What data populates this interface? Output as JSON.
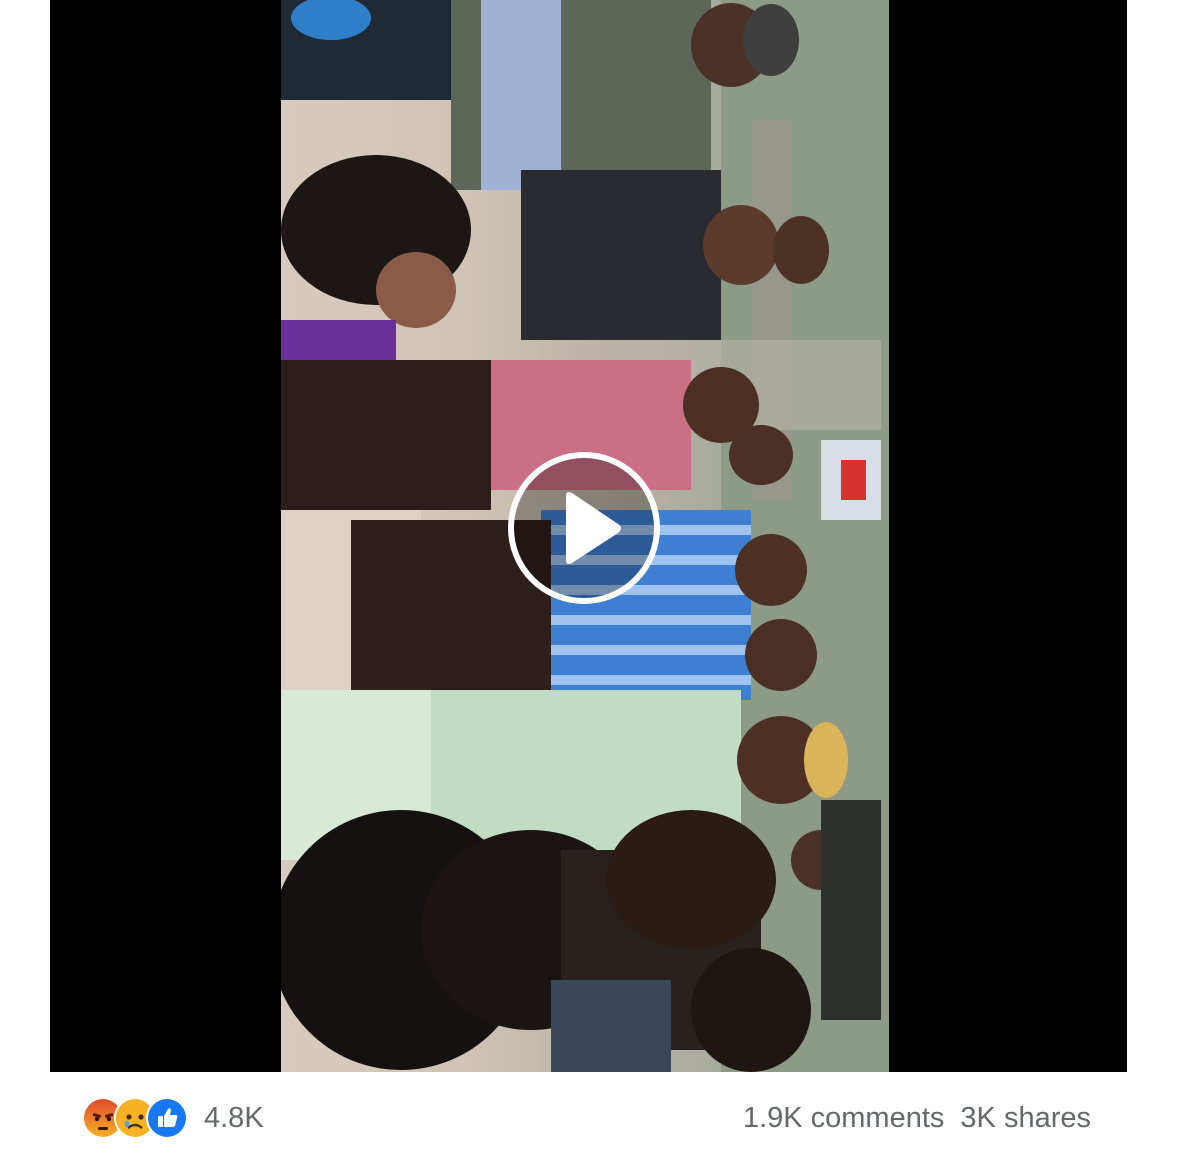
{
  "video": {
    "state": "paused",
    "play_icon": "play-icon",
    "accent": "#ffffff"
  },
  "reactions": {
    "icons": [
      "angry-reaction-icon",
      "sad-reaction-icon",
      "like-reaction-icon"
    ],
    "count": "4.8K"
  },
  "engagement": {
    "comments": "1.9K comments",
    "shares": "3K shares"
  },
  "colors": {
    "letterbox": "#000000",
    "meta_text": "#65676b",
    "like_blue": "#1877f2",
    "angry_orange": "#e9710f",
    "sad_yellow": "#f7b125"
  }
}
